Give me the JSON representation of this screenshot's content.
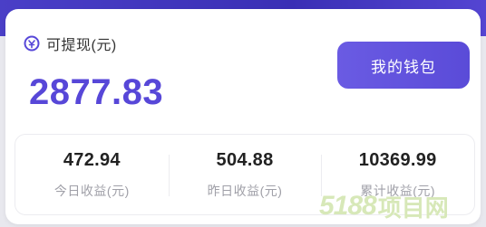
{
  "colors": {
    "accent": "#5747d8",
    "button_gradient_start": "#6a5be3",
    "button_gradient_end": "#5a4bd8",
    "muted_text": "#a0a0a8",
    "watermark": "#d7e8b8"
  },
  "balance": {
    "icon": "coin-icon",
    "label": "可提现(元)",
    "value": "2877.83"
  },
  "wallet_button": {
    "label": "我的钱包"
  },
  "stats": [
    {
      "value": "472.94",
      "label": "今日收益(元)"
    },
    {
      "value": "504.88",
      "label": "昨日收益(元)"
    },
    {
      "value": "10369.99",
      "label": "累计收益(元)"
    }
  ],
  "watermark": {
    "digits": "5188",
    "text": "项目网"
  }
}
